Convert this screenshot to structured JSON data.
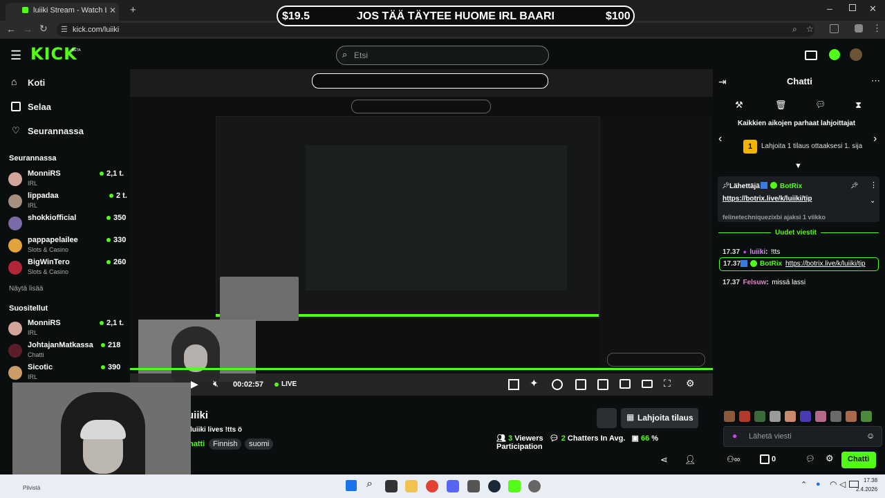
{
  "browser": {
    "tab_title": "luiiki Stream - Watch Live on Ki",
    "url": "kick.com/luiiki"
  },
  "goal": {
    "left": "$19.5",
    "text": "JOS TÄÄ TÄYTEE HUOME IRL BAARI",
    "right": "$100"
  },
  "header": {
    "logo": "KICK",
    "logo_beta": "BETA",
    "search_placeholder": "Etsi"
  },
  "sidebar": {
    "nav": [
      {
        "label": "Koti"
      },
      {
        "label": "Selaa"
      },
      {
        "label": "Seurannassa"
      }
    ],
    "following_title": "Seurannassa",
    "following": [
      {
        "name": "MonniRS",
        "category": "IRL",
        "viewers": "2,1 t."
      },
      {
        "name": "lippadaa",
        "category": "IRL",
        "viewers": "2 t."
      },
      {
        "name": "shokkiofficial",
        "category": "",
        "viewers": "350"
      },
      {
        "name": "pappapelailee",
        "category": "Slots & Casino",
        "viewers": "330"
      },
      {
        "name": "BigWinTero",
        "category": "Slots & Casino",
        "viewers": "260"
      }
    ],
    "show_more": "Näytä lisää",
    "recommended_title": "Suositellut",
    "recommended": [
      {
        "name": "MonniRS",
        "category": "IRL",
        "viewers": "2,1 t."
      },
      {
        "name": "JohtajanMatkassa",
        "category": "Chatti",
        "viewers": "218"
      },
      {
        "name": "Sicotic",
        "category": "IRL",
        "viewers": "390"
      }
    ]
  },
  "player": {
    "time": "00:02:57",
    "live": "LIVE",
    "streamer": "uiiki",
    "stream_title": "luiiki lives !tts ö",
    "category": "hatti",
    "tags": [
      "Finnish",
      "suomi"
    ],
    "gift_button": "Lahjoita tilaus",
    "viewers_count": "3",
    "viewers_label": "Viewers",
    "chatters_count": "2",
    "chatters_label": "Chatters In Avg.",
    "participation_count": "66",
    "participation_label": "% Participation"
  },
  "chat": {
    "title": "Chatti",
    "leaderboard_title": "Kaikkien aikojen parhaat lahjoittajat",
    "leaderboard_rank": "1",
    "leaderboard_text": "Lahjoita 1 tilaus ottaaksesi 1. sija",
    "pinned_label": "Lähettäjä",
    "pinned_user": "BotRix",
    "pinned_link": "https://botrix.live/k/luiiki/tip",
    "pinned_sub": "felinetechniquezixbi ajaksi 1 viikko",
    "new_messages": "Uudet viestit",
    "messages": [
      {
        "time": "17.37",
        "user": "luiiki",
        "text": "!tts"
      },
      {
        "time": "17.37",
        "user": "BotRix",
        "text": "https://botrix.live/k/luiiki/tip"
      },
      {
        "time": "17.37",
        "user": "Felsuw",
        "text": "missä lassi"
      }
    ],
    "input_placeholder": "Lähetä viesti",
    "points": "0",
    "send_button": "Chatti"
  },
  "taskbar": {
    "time": "17.38",
    "date": "2.4.2026",
    "webcam_label": "Pilvistä"
  },
  "colors": {
    "accent": "#53fc18",
    "background": "#0b0e0f"
  }
}
